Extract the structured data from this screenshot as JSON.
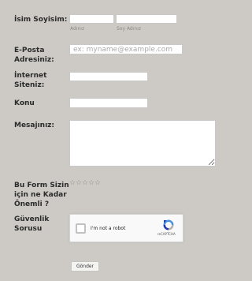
{
  "form": {
    "name": {
      "label": "İsim Soyisim:",
      "first_sub": "Adınız",
      "last_sub": "Soy Adınız",
      "first_value": "",
      "last_value": ""
    },
    "email": {
      "label_line1": "E-Posta",
      "label_line2": "Adresiniz:",
      "placeholder": "ex: myname@example.com",
      "value": ""
    },
    "website": {
      "label_line1": "İnternet",
      "label_line2": "Siteniz:",
      "value": ""
    },
    "subject": {
      "label": "Konu",
      "value": ""
    },
    "message": {
      "label": "Mesajınız:",
      "value": ""
    },
    "rating": {
      "label_line1": "Bu Form Sizin",
      "label_line2": "için ne Kadar",
      "label_line3": "Önemli ?",
      "max_stars": 5,
      "selected": 0,
      "star_glyph": "☆"
    },
    "security": {
      "label_line1": "Güvenlik",
      "label_line2": "Sorusu",
      "captcha_text": "I'm not a robot",
      "captcha_brand": "reCAPTCHA",
      "brand_colors": [
        "#1c3aa9",
        "#4a90e2",
        "#b0b0b0"
      ]
    },
    "submit_label": "Gönder"
  },
  "colors": {
    "background": "#cdcac5",
    "label_text": "#2b2b2b",
    "input_bg": "#ffffff"
  }
}
